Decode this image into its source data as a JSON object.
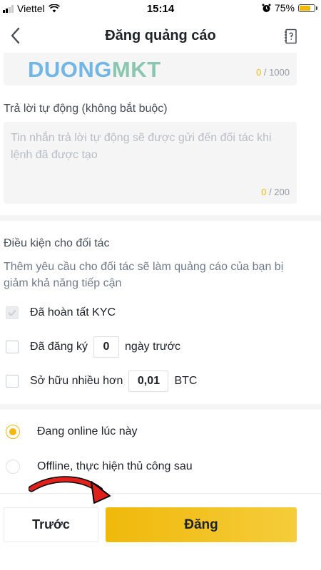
{
  "status_bar": {
    "carrier": "Viettel",
    "time": "15:14",
    "battery_percent": "75%",
    "battery_level": 0.75
  },
  "nav": {
    "title": "Đăng quảng cáo",
    "back_icon": "chevron-left-icon",
    "doc_icon": "document-question-icon"
  },
  "terms_field": {
    "watermark_a": "DUONG",
    "watermark_b": "MKT",
    "counter_current": "0",
    "counter_max": " / 1000"
  },
  "auto_reply": {
    "label": "Trả lời tự động (không bắt buộc)",
    "placeholder": "Tin nhắn trả lời tự động sẽ được gửi đến đối tác khi lệnh đã được tạo",
    "counter_current": "0",
    "counter_max": " / 200"
  },
  "partner_conditions": {
    "title": "Điều kiện cho đối tác",
    "description": "Thêm yêu cầu cho đối tác sẽ làm quảng cáo của bạn bị giảm khả năng tiếp cận",
    "kyc": {
      "label": "Đã hoàn tất KYC",
      "checked": true
    },
    "registered": {
      "label_before": "Đã đăng ký",
      "value": "0",
      "label_after": "ngày trước",
      "checked": false
    },
    "holdings": {
      "label_before": "Sở hữu nhiều hơn",
      "value": "0,01",
      "label_after": "BTC",
      "checked": false
    }
  },
  "availability": {
    "online": {
      "label": "Đang online lúc này",
      "selected": true
    },
    "offline": {
      "label": "Offline, thực hiện thủ công sau",
      "selected": false
    }
  },
  "footer": {
    "prev_label": "Trước",
    "post_label": "Đăng"
  },
  "colors": {
    "accent": "#f0b90b",
    "annotation_arrow": "#e0201b"
  }
}
